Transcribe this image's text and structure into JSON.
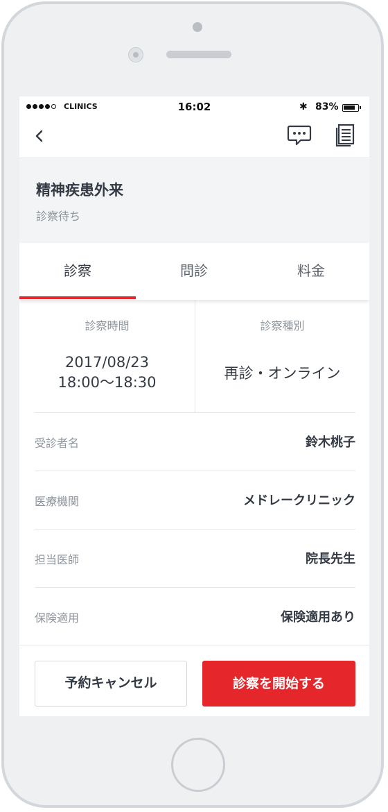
{
  "status_bar": {
    "carrier": "CLINICS",
    "time": "16:02",
    "battery_percent": "83%",
    "battery_level": 0.83,
    "signal_bars": 4
  },
  "header": {
    "title": "精神疾患外来",
    "status": "診察待ち"
  },
  "tabs": [
    {
      "label": "診察",
      "active": true
    },
    {
      "label": "問診",
      "active": false
    },
    {
      "label": "料金",
      "active": false
    }
  ],
  "summary": {
    "time_label": "診察時間",
    "date": "2017/08/23",
    "time_range": "18:00〜18:30",
    "type_label": "診察種別",
    "type_value": "再診・オンライン"
  },
  "details": [
    {
      "label": "受診者名",
      "value": "鈴木桃子"
    },
    {
      "label": "医療機関",
      "value": "メドレークリニック"
    },
    {
      "label": "担当医師",
      "value": "院長先生"
    },
    {
      "label": "保険適用",
      "value": "保険適用あり"
    }
  ],
  "footer": {
    "cancel_label": "予約キャンセル",
    "start_label": "診察を開始する"
  },
  "colors": {
    "accent": "#e5262b",
    "text": "#333a44",
    "muted": "#8d949c"
  },
  "icons": {
    "back": "chevron-left-icon",
    "chat": "chat-bubble-icon",
    "document": "document-icon"
  }
}
